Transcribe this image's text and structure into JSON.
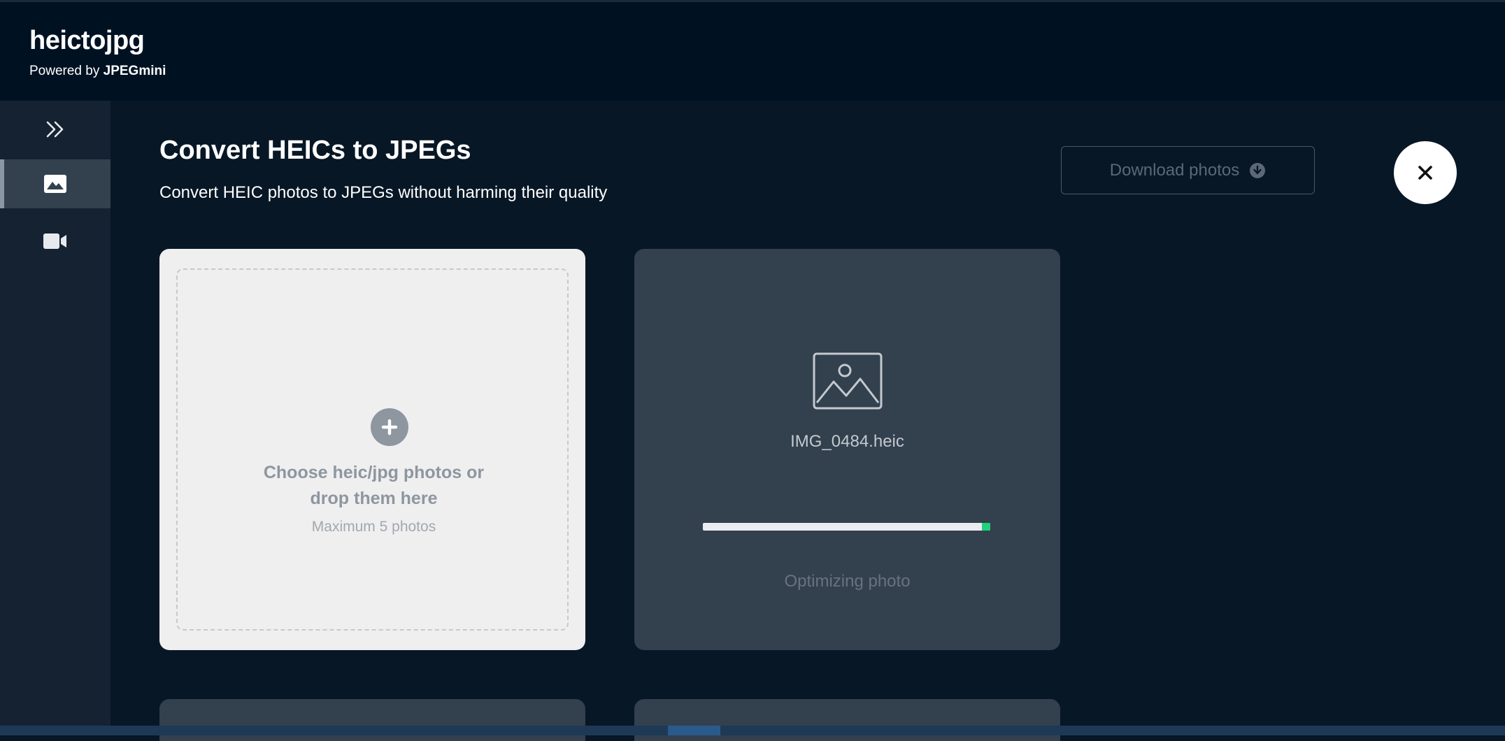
{
  "header": {
    "app_name": "heictojpg",
    "powered_prefix": "Powered by ",
    "powered_brand": "JPEGmini"
  },
  "sidebar": {
    "items": [
      {
        "icon": "double-chevron-right-icon",
        "active": false
      },
      {
        "icon": "image-icon",
        "active": true
      },
      {
        "icon": "video-camera-icon",
        "active": false
      }
    ]
  },
  "main": {
    "title": "Convert HEICs to JPEGs",
    "subtitle": "Convert HEIC photos to JPEGs without harming their quality",
    "download_label": "Download photos",
    "close_icon": "close-icon"
  },
  "upload": {
    "line1": "Choose heic/jpg photos or",
    "line2": "drop them here",
    "limit": "Maximum 5 photos"
  },
  "photo": {
    "filename": "IMG_0484.heic",
    "status": "Optimizing photo",
    "progress": 0.97
  },
  "colors": {
    "background": "#071726",
    "header": "#001222",
    "sidebar": "#142232",
    "card": "#33404e",
    "upload_card": "#efefef",
    "progress_accent": "#1fd37a"
  }
}
